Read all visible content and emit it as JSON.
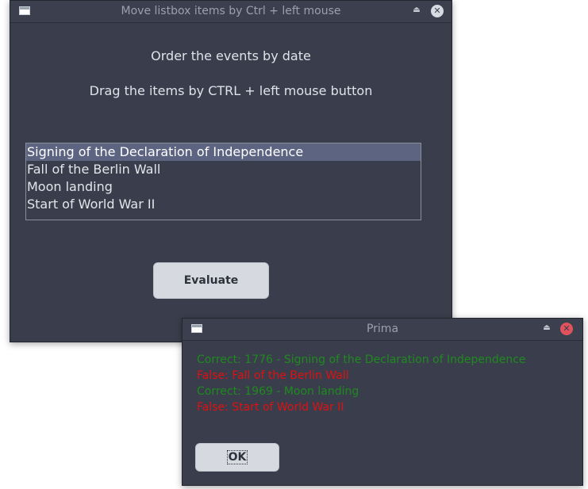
{
  "main_window": {
    "title": "Move listbox items by Ctrl + left mouse",
    "heading": "Order the events by date",
    "instruction": "Drag the items by CTRL + left mouse button",
    "list_items": [
      "Signing of the Declaration of Independence",
      "Fall of the Berlin Wall",
      "Moon landing",
      "Start of World War II"
    ],
    "selected_item": "Signing of the Declaration of Independence",
    "evaluate_label": "Evaluate",
    "shade_icon": "eject-icon",
    "close_icon": "close-icon"
  },
  "dialog": {
    "title": "Prima",
    "results": [
      {
        "text": "Correct: 1776 - Signing of the Declaration of Independence",
        "status": "correct"
      },
      {
        "text": "False: Fall of the Berlin Wall",
        "status": "false"
      },
      {
        "text": "Correct: 1969 - Moon landing",
        "status": "correct"
      },
      {
        "text": "False: Start of World War II",
        "status": "false"
      }
    ],
    "ok_label": "OK"
  },
  "colors": {
    "window_bg": "#3a3e4c",
    "correct": "#1e8a1e",
    "false": "#dd1111",
    "selection": "#5c6482",
    "close_red": "#e0535d"
  }
}
